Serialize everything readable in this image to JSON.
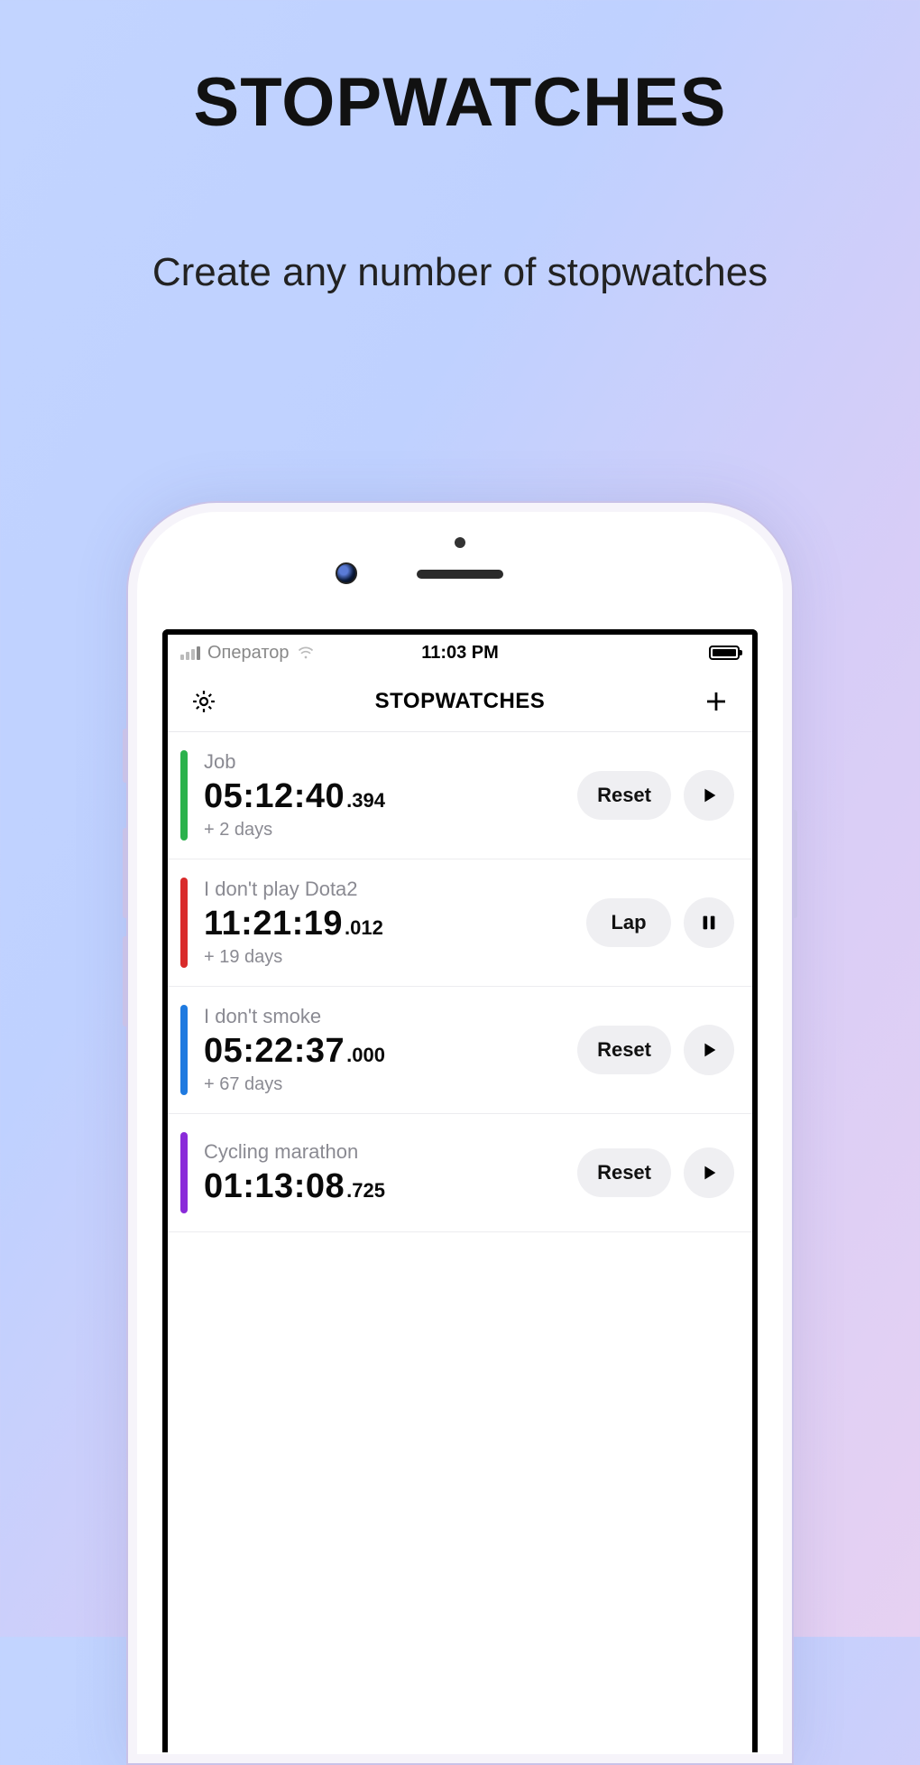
{
  "promo": {
    "title": "STOPWATCHES",
    "subtitle": "Create any number of stopwatches"
  },
  "status": {
    "carrier": "Оператор",
    "time": "11:03 PM"
  },
  "nav": {
    "title": "STOPWATCHES"
  },
  "buttons": {
    "reset": "Reset",
    "lap": "Lap"
  },
  "colors": {
    "green": "#2bb24c",
    "red": "#d92b2b",
    "blue": "#1f7ae0",
    "purple": "#8a2bd9"
  },
  "stopwatches": [
    {
      "label": "Job",
      "time": "05:12:40",
      "ms": ".394",
      "sub": "+ 2 days",
      "stripe": "green",
      "primary": "reset",
      "control": "play"
    },
    {
      "label": "I don't play Dota2",
      "time": "11:21:19",
      "ms": ".012",
      "sub": "+ 19 days",
      "stripe": "red",
      "primary": "lap",
      "control": "pause"
    },
    {
      "label": "I don't smoke",
      "time": "05:22:37",
      "ms": ".000",
      "sub": "+ 67 days",
      "stripe": "blue",
      "primary": "reset",
      "control": "play"
    },
    {
      "label": "Cycling marathon",
      "time": "01:13:08",
      "ms": ".725",
      "sub": "",
      "stripe": "purple",
      "primary": "reset",
      "control": "play"
    }
  ]
}
